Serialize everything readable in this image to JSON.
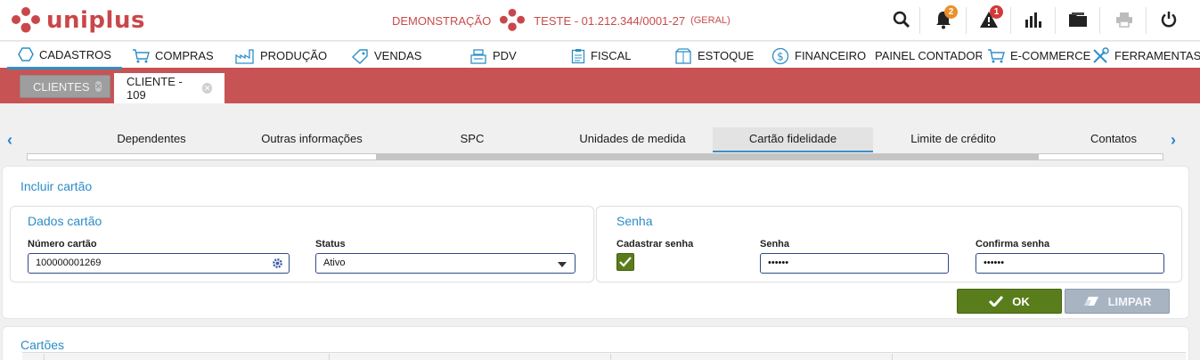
{
  "app": {
    "logo_text": "uniplus",
    "environment": "DEMONSTRAÇÃO",
    "company": "TESTE - 01.212.344/0001-27",
    "company_suffix": "(GERAL)",
    "brand_color": "#c9474a"
  },
  "toolbar": {
    "icons": [
      "search-icon",
      "bell-icon",
      "alert-icon",
      "chart-icon",
      "folder-icon",
      "printer-icon",
      "power-icon"
    ],
    "notifications_badge": "2",
    "alerts_badge": "1"
  },
  "menu": {
    "items": [
      {
        "label": "CADASTROS",
        "icon": "hexagon-icon",
        "active": true
      },
      {
        "label": "COMPRAS",
        "icon": "cart-icon"
      },
      {
        "label": "PRODUÇÃO",
        "icon": "factory-icon"
      },
      {
        "label": "VENDAS",
        "icon": "tag-icon"
      },
      {
        "label": "PDV",
        "icon": "register-icon"
      },
      {
        "label": "FISCAL",
        "icon": "clipboard-icon"
      },
      {
        "label": "ESTOQUE",
        "icon": "box-icon"
      },
      {
        "label": "FINANCEIRO",
        "icon": "dollar-icon"
      },
      {
        "label": "PAINEL CONTADOR",
        "icon": "document-icon"
      },
      {
        "label": "E-COMMERCE",
        "icon": "cart-icon"
      },
      {
        "label": "FERRAMENTAS",
        "icon": "tools-icon"
      }
    ]
  },
  "doc_tabs": [
    {
      "label": "CLIENTES",
      "active": false
    },
    {
      "label": "CLIENTE - 109",
      "active": true
    }
  ],
  "sub_tabs": {
    "items": [
      "Dependentes",
      "Outras informações",
      "SPC",
      "Unidades de medida",
      "Cartão fidelidade",
      "Limite de crédito",
      "Contatos"
    ],
    "active": "Cartão fidelidade"
  },
  "form": {
    "title": "Incluir cartão",
    "card_section": {
      "title": "Dados cartão",
      "number_label": "Número cartão",
      "number_value": "100000001269",
      "status_label": "Status",
      "status_value": "Ativo"
    },
    "password_section": {
      "title": "Senha",
      "register_label": "Cadastrar senha",
      "register_checked": true,
      "password_label": "Senha",
      "password_value": "••••••",
      "confirm_label": "Confirma senha",
      "confirm_value": "••••••"
    },
    "ok_label": "OK",
    "clear_label": "LIMPAR"
  },
  "cards": {
    "title": "Cartões"
  }
}
